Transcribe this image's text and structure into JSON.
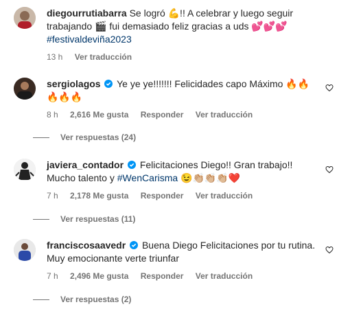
{
  "caption": {
    "username": "diegourrutiabarra",
    "text_1": "Se logró 💪!! A celebrar y luego seguir trabajando 🎬 fui demasiado feliz gracias a uds 💕💕💕",
    "hashtag": "#festivaldeviña2023",
    "time": "13 h",
    "translate": "Ver traducción"
  },
  "comments": [
    {
      "username": "sergiolagos",
      "text": "Ye ye ye!!!!!!! Felicidades capo Máximo 🔥🔥🔥🔥🔥",
      "time": "8 h",
      "likes": "2,616 Me gusta",
      "reply": "Responder",
      "translate": "Ver traducción",
      "replies": "Ver respuestas (24)"
    },
    {
      "username": "javiera_contador",
      "text_1": "Felicitaciones Diego!! Gran trabajo!! Mucho talento y",
      "hashtag": "#WenCarisma",
      "text_2": "😉👏🏼👏🏼👏🏼❤️",
      "time": "7 h",
      "likes": "2,178 Me gusta",
      "reply": "Responder",
      "translate": "Ver traducción",
      "replies": "Ver respuestas (11)"
    },
    {
      "username": "franciscosaavedr",
      "text": "Buena Diego Felicitaciones por tu rutina. Muy emocionante verte triunfar",
      "time": "7 h",
      "likes": "2,496 Me gusta",
      "reply": "Responder",
      "translate": "Ver traducción",
      "replies": "Ver respuestas (2)"
    }
  ],
  "colors": {
    "verified": "#0095f6",
    "link": "#00376b",
    "muted": "#737373"
  }
}
